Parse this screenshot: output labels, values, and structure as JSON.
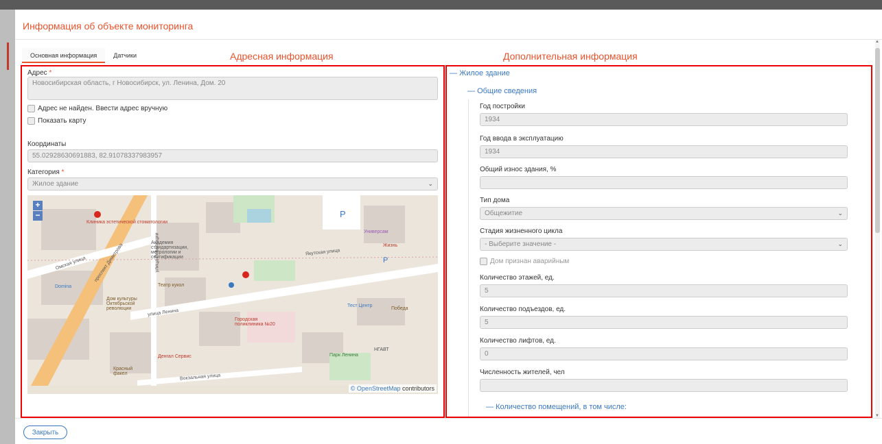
{
  "modal": {
    "title": "Информация об объекте мониторинга"
  },
  "tabs": [
    {
      "label": "Основная информация",
      "active": true
    },
    {
      "label": "Датчики",
      "active": false
    }
  ],
  "headings": {
    "address": "Адресная информация",
    "additional": "Дополнительная информация"
  },
  "address_panel": {
    "address_label": "Адрес",
    "address_value": "Новосибирская область, г Новосибирск, ул. Ленина, Дом. 20",
    "checkbox_manual": "Адрес не найден. Ввести адрес вручную",
    "checkbox_map": "Показать карту",
    "coords_label": "Координаты",
    "coords_value": "55.02928630691883, 82.91078337983957",
    "category_label": "Категория",
    "category_value": "Жилое здание"
  },
  "map": {
    "zoom_in": "+",
    "zoom_out": "−",
    "attribution_link": "© OpenStreetMap",
    "attribution_text": " contributors",
    "labels": [
      "Клиника эстетической стоматологии",
      "Академия стандартизации, метрологии и сертификации",
      "Омская улица",
      "проспект Димитрова",
      "улица Революции",
      "Театр кукол",
      "Дом культуры Октябрьской революции",
      "улица Ленина",
      "Городская поликлиника №20",
      "Универсам",
      "Жизнь",
      "Тест Центр",
      "Победа",
      "Парк Ленина",
      "НГАВТ",
      "Денгал Сервис",
      "Красный факел",
      "Domina",
      "Вокзальная улица",
      "Якутская улица"
    ]
  },
  "details_panel": {
    "node_building": "Жилое здание",
    "node_general": "Общие сведения",
    "year_built_label": "Год постройки",
    "year_built_value": "1934",
    "year_commission_label": "Год ввода в эксплуатацию",
    "year_commission_value": "1934",
    "wear_label": "Общий износ здания, %",
    "wear_value": "",
    "house_type_label": "Тип дома",
    "house_type_value": "Общежитие",
    "lifecycle_label": "Стадия жизненного цикла",
    "lifecycle_value": "- Выберите значение -",
    "emergency_label": "Дом признан аварийным",
    "floors_label": "Количество этажей, ед.",
    "floors_value": "5",
    "entrances_label": "Количество подъездов, ед.",
    "entrances_value": "5",
    "elevators_label": "Количество лифтов, ед.",
    "elevators_value": "0",
    "residents_label": "Численность жителей, чел",
    "residents_value": "",
    "node_rooms": "Количество помещений, в том числе:"
  },
  "footer": {
    "close_label": "Закрыть"
  },
  "colors": {
    "accent": "#e8532c",
    "link": "#3a78c2",
    "annotation": "#e00000"
  }
}
